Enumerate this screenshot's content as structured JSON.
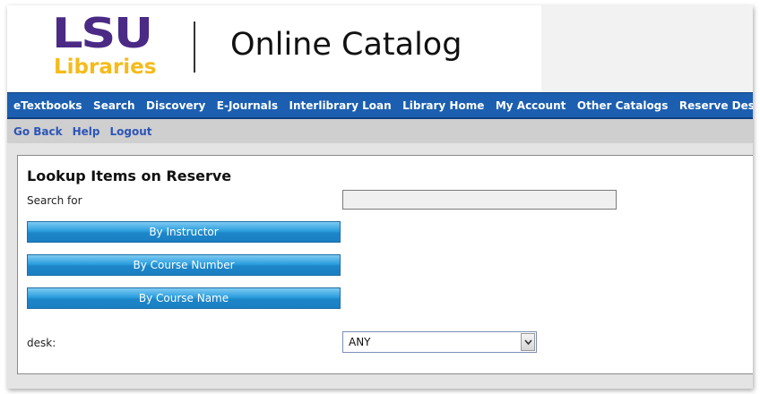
{
  "header": {
    "logo_top": "LSU",
    "logo_bottom": "Libraries",
    "title": "Online Catalog"
  },
  "nav": {
    "items": [
      {
        "label": "eTextbooks"
      },
      {
        "label": "Search"
      },
      {
        "label": "Discovery"
      },
      {
        "label": "E-Journals"
      },
      {
        "label": "Interlibrary Loan"
      },
      {
        "label": "Library Home"
      },
      {
        "label": "My Account"
      },
      {
        "label": "Other Catalogs"
      },
      {
        "label": "Reserve Desk"
      }
    ]
  },
  "subnav": {
    "items": [
      {
        "label": "Go Back"
      },
      {
        "label": "Help"
      },
      {
        "label": "Logout"
      }
    ]
  },
  "form": {
    "title": "Lookup Items on Reserve",
    "search_label": "Search for",
    "search_value": "",
    "buttons": {
      "instructor": "By Instructor",
      "course_number": "By Course Number",
      "course_name": "By Course Name"
    },
    "desk_label": "desk:",
    "desk_value": "ANY"
  },
  "colors": {
    "brand_purple": "#4b2a86",
    "brand_gold": "#f5bb1b",
    "nav_blue": "#1c5fb0",
    "link_blue": "#2d55b8",
    "button_blue": "#2b9ede"
  },
  "icons": {
    "select_arrow": "chevron-down-icon"
  }
}
